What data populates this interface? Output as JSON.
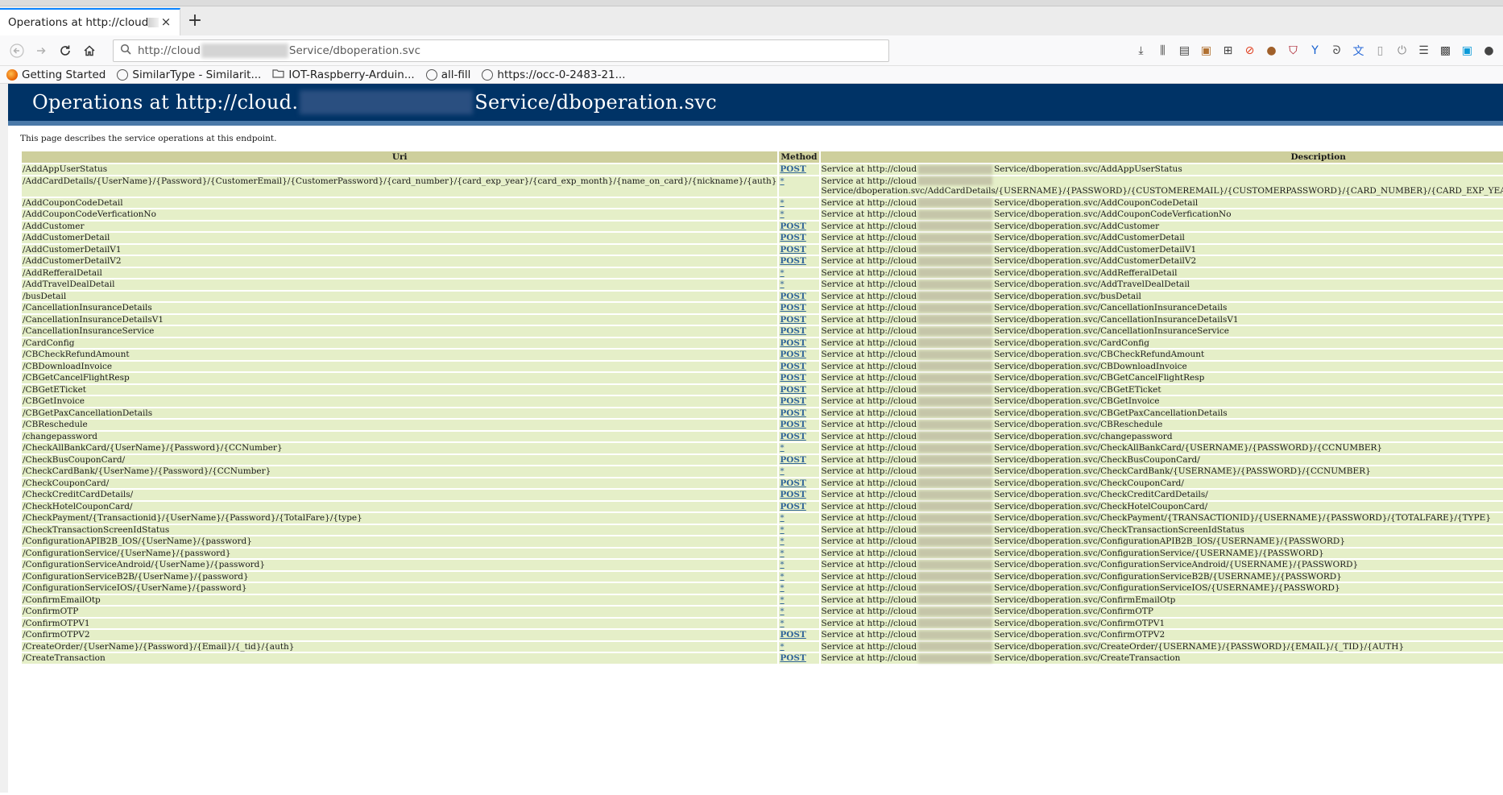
{
  "browser": {
    "tab_title": "Operations at http://cloud",
    "tab_close": "×",
    "newtab": "+",
    "url_prefix": "http://cloud",
    "url_suffix": "Service/dboperation.svc",
    "bookmarks": [
      {
        "label": "Getting Started",
        "icon": "firefox-icon",
        "color": "#e66000"
      },
      {
        "label": "SimilarType - Similarit...",
        "icon": "globe-icon",
        "color": "#555555"
      },
      {
        "label": "IOT-Raspberry-Arduin...",
        "icon": "folder-icon",
        "color": "#666666"
      },
      {
        "label": "all-fill",
        "icon": "globe-icon",
        "color": "#555555"
      },
      {
        "label": "https://occ-0-2483-21...",
        "icon": "globe-icon",
        "color": "#555555"
      }
    ]
  },
  "page": {
    "heading_prefix": "Operations at http://cloud.",
    "heading_suffix": "Service/dboperation.svc",
    "intro": "This page describes the service operations at this endpoint.",
    "columns": [
      "Uri",
      "Method",
      "Description"
    ],
    "desc_prefix": "Service at http://cloud",
    "rows": [
      {
        "uri": "/AddAppUserStatus",
        "method": "POST",
        "desc": "Service/dboperation.svc/AddAppUserStatus"
      },
      {
        "uri": "/AddCardDetails/{UserName}/{Password}/{CustomerEmail}/{CustomerPassword}/{card_number}/{card_exp_year}/{card_exp_month}/{name_on_card}/{nickname}/{auth}",
        "method": "*",
        "desc": "Service/dboperation.svc/AddCardDetails/{USERNAME}/{PASSWORD}/{CUSTOMEREMAIL}/{CUSTOMERPASSWORD}/{CARD_NUMBER}/{CARD_EXP_YEAR}/{CARD_EXP_MONTH}/{NAME_ON_CARD}/{NICKNAME}/{AUTH}"
      },
      {
        "uri": "/AddCouponCodeDetail",
        "method": "*",
        "desc": "Service/dboperation.svc/AddCouponCodeDetail"
      },
      {
        "uri": "/AddCouponCodeVerficationNo",
        "method": "*",
        "desc": "Service/dboperation.svc/AddCouponCodeVerficationNo"
      },
      {
        "uri": "/AddCustomer",
        "method": "POST",
        "desc": "Service/dboperation.svc/AddCustomer"
      },
      {
        "uri": "/AddCustomerDetail",
        "method": "POST",
        "desc": "Service/dboperation.svc/AddCustomerDetail"
      },
      {
        "uri": "/AddCustomerDetailV1",
        "method": "POST",
        "desc": "Service/dboperation.svc/AddCustomerDetailV1"
      },
      {
        "uri": "/AddCustomerDetailV2",
        "method": "POST",
        "desc": "Service/dboperation.svc/AddCustomerDetailV2"
      },
      {
        "uri": "/AddRefferalDetail",
        "method": "*",
        "desc": "Service/dboperation.svc/AddRefferalDetail"
      },
      {
        "uri": "/AddTravelDealDetail",
        "method": "*",
        "desc": "Service/dboperation.svc/AddTravelDealDetail"
      },
      {
        "uri": "/busDetail",
        "method": "POST",
        "desc": "Service/dboperation.svc/busDetail"
      },
      {
        "uri": "/CancellationInsuranceDetails",
        "method": "POST",
        "desc": "Service/dboperation.svc/CancellationInsuranceDetails"
      },
      {
        "uri": "/CancellationInsuranceDetailsV1",
        "method": "POST",
        "desc": "Service/dboperation.svc/CancellationInsuranceDetailsV1"
      },
      {
        "uri": "/CancellationInsuranceService",
        "method": "POST",
        "desc": "Service/dboperation.svc/CancellationInsuranceService"
      },
      {
        "uri": "/CardConfig",
        "method": "POST",
        "desc": "Service/dboperation.svc/CardConfig"
      },
      {
        "uri": "/CBCheckRefundAmount",
        "method": "POST",
        "desc": "Service/dboperation.svc/CBCheckRefundAmount"
      },
      {
        "uri": "/CBDownloadInvoice",
        "method": "POST",
        "desc": "Service/dboperation.svc/CBDownloadInvoice"
      },
      {
        "uri": "/CBGetCancelFlightResp",
        "method": "POST",
        "desc": "Service/dboperation.svc/CBGetCancelFlightResp"
      },
      {
        "uri": "/CBGetETicket",
        "method": "POST",
        "desc": "Service/dboperation.svc/CBGetETicket"
      },
      {
        "uri": "/CBGetInvoice",
        "method": "POST",
        "desc": "Service/dboperation.svc/CBGetInvoice"
      },
      {
        "uri": "/CBGetPaxCancellationDetails",
        "method": "POST",
        "desc": "Service/dboperation.svc/CBGetPaxCancellationDetails"
      },
      {
        "uri": "/CBReschedule",
        "method": "POST",
        "desc": "Service/dboperation.svc/CBReschedule"
      },
      {
        "uri": "/changepassword",
        "method": "POST",
        "desc": "Service/dboperation.svc/changepassword"
      },
      {
        "uri": "/CheckAllBankCard/{UserName}/{Password}/{CCNumber}",
        "method": "*",
        "desc": "Service/dboperation.svc/CheckAllBankCard/{USERNAME}/{PASSWORD}/{CCNUMBER}"
      },
      {
        "uri": "/CheckBusCouponCard/",
        "method": "POST",
        "desc": "Service/dboperation.svc/CheckBusCouponCard/"
      },
      {
        "uri": "/CheckCardBank/{UserName}/{Password}/{CCNumber}",
        "method": "*",
        "desc": "Service/dboperation.svc/CheckCardBank/{USERNAME}/{PASSWORD}/{CCNUMBER}"
      },
      {
        "uri": "/CheckCouponCard/",
        "method": "POST",
        "desc": "Service/dboperation.svc/CheckCouponCard/"
      },
      {
        "uri": "/CheckCreditCardDetails/",
        "method": "POST",
        "desc": "Service/dboperation.svc/CheckCreditCardDetails/"
      },
      {
        "uri": "/CheckHotelCouponCard/",
        "method": "POST",
        "desc": "Service/dboperation.svc/CheckHotelCouponCard/"
      },
      {
        "uri": "/CheckPayment/{Transactionid}/{UserName}/{Password}/{TotalFare}/{type}",
        "method": "*",
        "desc": "Service/dboperation.svc/CheckPayment/{TRANSACTIONID}/{USERNAME}/{PASSWORD}/{TOTALFARE}/{TYPE}"
      },
      {
        "uri": "/CheckTransactionScreenIdStatus",
        "method": "*",
        "desc": "Service/dboperation.svc/CheckTransactionScreenIdStatus"
      },
      {
        "uri": "/ConfigurationAPIB2B_IOS/{UserName}/{password}",
        "method": "*",
        "desc": "Service/dboperation.svc/ConfigurationAPIB2B_IOS/{USERNAME}/{PASSWORD}"
      },
      {
        "uri": "/ConfigurationService/{UserName}/{password}",
        "method": "*",
        "desc": "Service/dboperation.svc/ConfigurationService/{USERNAME}/{PASSWORD}"
      },
      {
        "uri": "/ConfigurationServiceAndroid/{UserName}/{password}",
        "method": "*",
        "desc": "Service/dboperation.svc/ConfigurationServiceAndroid/{USERNAME}/{PASSWORD}"
      },
      {
        "uri": "/ConfigurationServiceB2B/{UserName}/{password}",
        "method": "*",
        "desc": "Service/dboperation.svc/ConfigurationServiceB2B/{USERNAME}/{PASSWORD}"
      },
      {
        "uri": "/ConfigurationServiceIOS/{UserName}/{password}",
        "method": "*",
        "desc": "Service/dboperation.svc/ConfigurationServiceIOS/{USERNAME}/{PASSWORD}"
      },
      {
        "uri": "/ConfirmEmailOtp",
        "method": "*",
        "desc": "Service/dboperation.svc/ConfirmEmailOtp"
      },
      {
        "uri": "/ConfirmOTP",
        "method": "*",
        "desc": "Service/dboperation.svc/ConfirmOTP"
      },
      {
        "uri": "/ConfirmOTPV1",
        "method": "*",
        "desc": "Service/dboperation.svc/ConfirmOTPV1"
      },
      {
        "uri": "/ConfirmOTPV2",
        "method": "POST",
        "desc": "Service/dboperation.svc/ConfirmOTPV2"
      },
      {
        "uri": "/CreateOrder/{UserName}/{Password}/{Email}/{_tid}/{auth}",
        "method": "*",
        "desc": "Service/dboperation.svc/CreateOrder/{USERNAME}/{PASSWORD}/{EMAIL}/{_TID}/{AUTH}"
      },
      {
        "uri": "/CreateTransaction",
        "method": "POST",
        "desc": "Service/dboperation.svc/CreateTransaction"
      }
    ]
  }
}
